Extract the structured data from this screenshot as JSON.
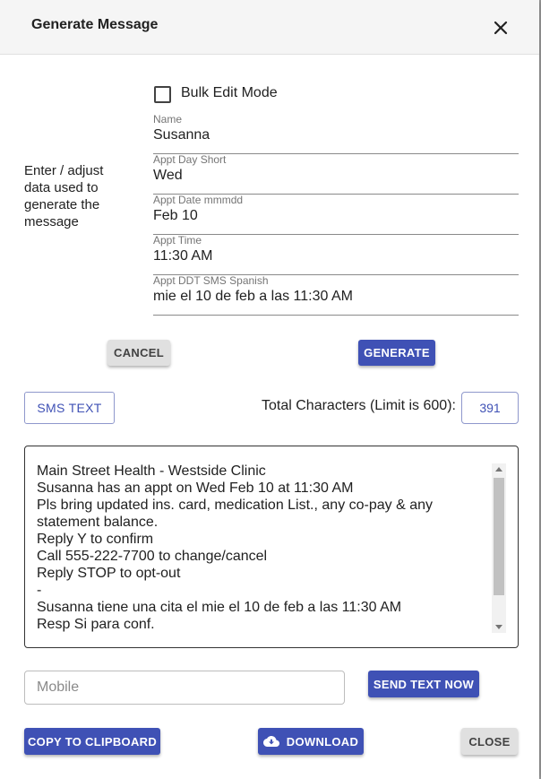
{
  "dialog": {
    "title": "Generate Message",
    "close_icon_label": "close-icon"
  },
  "form": {
    "instructions": "Enter / adjust data used to generate the message",
    "bulk_edit_label": "Bulk Edit Mode",
    "bulk_edit_checked": false,
    "fields": [
      {
        "label": "Name",
        "value": "Susanna"
      },
      {
        "label": "Appt Day Short",
        "value": "Wed"
      },
      {
        "label": "Appt Date mmmdd",
        "value": "Feb 10"
      },
      {
        "label": "Appt Time",
        "value": "11:30 AM"
      },
      {
        "label": "Appt DDT SMS Spanish",
        "value": "mie el 10 de feb a las 11:30 AM"
      }
    ],
    "cancel_label": "CANCEL",
    "generate_label": "GENERATE"
  },
  "sms": {
    "type_button_label": "SMS TEXT",
    "total_label": "Total Characters (Limit is 600):",
    "total_count": "391",
    "lines": [
      "Main Street Health - Westside Clinic",
      "Susanna has an appt on Wed Feb 10 at 11:30 AM",
      "Pls bring updated ins. card, medication List., any co-pay & any",
      "statement balance.",
      "Reply Y to confirm",
      "Call 555-222-7700 to change/cancel",
      "Reply STOP to opt-out",
      "-",
      "Susanna tiene una cita el mie el 10 de feb a las 11:30 AM",
      "Resp Si para conf."
    ]
  },
  "send": {
    "mobile_placeholder": "Mobile",
    "send_label": "SEND TEXT NOW"
  },
  "footer": {
    "copy_label": "COPY TO CLIPBOARD",
    "download_label": "DOWNLOAD",
    "download_icon": "cloud-download-icon",
    "close_label": "CLOSE"
  },
  "colors": {
    "primary": "#3f51b5",
    "grey_button": "#e0e0e0",
    "header_bg": "#f5f5f5"
  }
}
